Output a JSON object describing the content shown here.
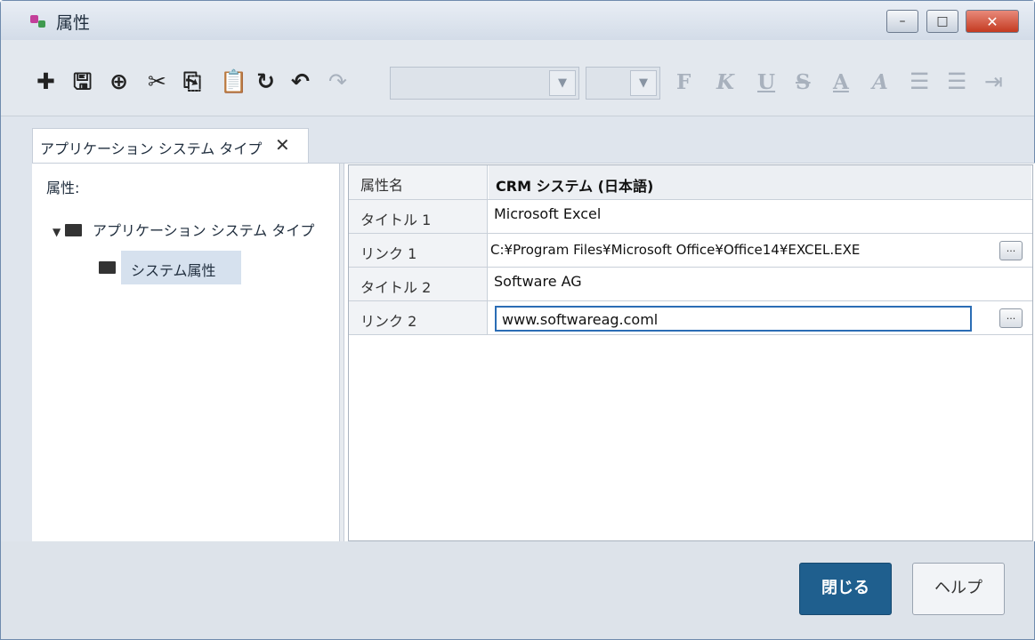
{
  "window": {
    "title": "属性",
    "min_glyph": "–",
    "max_glyph": "□",
    "close_glyph": "✕"
  },
  "toolbar": {
    "icons": [
      "add-icon",
      "save-icon",
      "add-copy-icon",
      "cut-icon",
      "copy-icon",
      "paste-icon",
      "refresh-icon",
      "undo-icon",
      "redo-icon"
    ],
    "font_combo_value": "",
    "size_combo_value": "",
    "format_labels": {
      "bold": "F",
      "italic": "K",
      "underline": "U",
      "strike": "S",
      "font_color": "A",
      "highlight": "A"
    }
  },
  "tab": {
    "label": "アプリケーション システム タイプ",
    "close": "✕"
  },
  "left": {
    "label": "属性:",
    "tree": [
      {
        "label": "アプリケーション システム タイプ",
        "expanded": true
      },
      {
        "label": "システム属性",
        "selected": true
      }
    ]
  },
  "grid": {
    "header": {
      "name": "属性名",
      "value": "CRM システム (日本語)"
    },
    "rows": [
      {
        "name": "タイトル 1",
        "value": "Microsoft Excel"
      },
      {
        "name": "リンク 1",
        "value": "C:¥Program Files¥Microsoft Office¥Office14¥EXCEL.EXE",
        "has_button": true
      },
      {
        "name": "タイトル 2",
        "value": "Software AG"
      },
      {
        "name": "リンク 2",
        "value": "www.softwareag.coml",
        "has_button": true,
        "editing": true
      }
    ],
    "ellipsis": "..."
  },
  "footer": {
    "close_label": "閉じる",
    "help_label": "ヘルプ"
  }
}
